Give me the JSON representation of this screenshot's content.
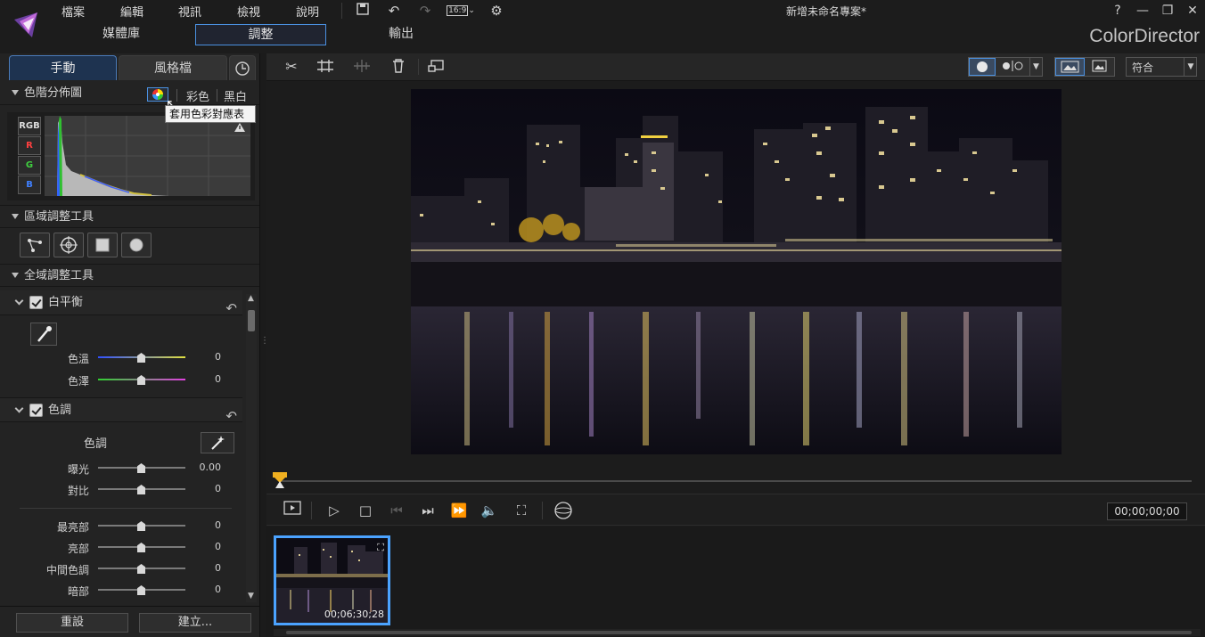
{
  "app": {
    "brand": "ColorDirector",
    "window_title": "新增未命名專案*",
    "aspect_label": "16:9"
  },
  "menu": [
    "檔案",
    "編輯",
    "視訊",
    "檢視",
    "說明"
  ],
  "window_controls": {
    "help": "?",
    "minimize": "—",
    "restore": "❐",
    "close": "✕"
  },
  "mode_tabs": [
    {
      "label": "媒體庫",
      "active": false
    },
    {
      "label": "調整",
      "active": true
    },
    {
      "label": "輸出",
      "active": false
    }
  ],
  "left_panel": {
    "tabs": [
      {
        "label": "手動",
        "active": true
      },
      {
        "label": "風格檔",
        "active": false
      }
    ],
    "histogram": {
      "title": "色階分佈圖",
      "mode_color": "彩色",
      "mode_bw": "黑白",
      "tooltip": "套用色彩對應表",
      "channels": [
        "RGB",
        "R",
        "G",
        "B"
      ]
    },
    "regional": {
      "title": "區域調整工具"
    },
    "global": {
      "title": "全域調整工具"
    },
    "white_balance": {
      "title": "白平衡",
      "sliders": [
        {
          "label": "色溫",
          "value": "0"
        },
        {
          "label": "色澤",
          "value": "0"
        }
      ]
    },
    "tone": {
      "title": "色調",
      "sub_label": "色調",
      "sliders": [
        {
          "label": "曝光",
          "value": "0.00"
        },
        {
          "label": "對比",
          "value": "0"
        },
        {
          "label": "最亮部",
          "value": "0"
        },
        {
          "label": "亮部",
          "value": "0"
        },
        {
          "label": "中間色調",
          "value": "0"
        },
        {
          "label": "暗部",
          "value": "0"
        }
      ]
    },
    "reset_button": "重設",
    "create_button": "建立..."
  },
  "viewer": {
    "fit_option": "符合",
    "timecode": "00;00;00;00"
  },
  "clips": [
    {
      "duration": "00;06;30;28",
      "selected": true
    }
  ],
  "colors": {
    "accent": "#4ba3ff",
    "playhead": "#f0b020"
  }
}
